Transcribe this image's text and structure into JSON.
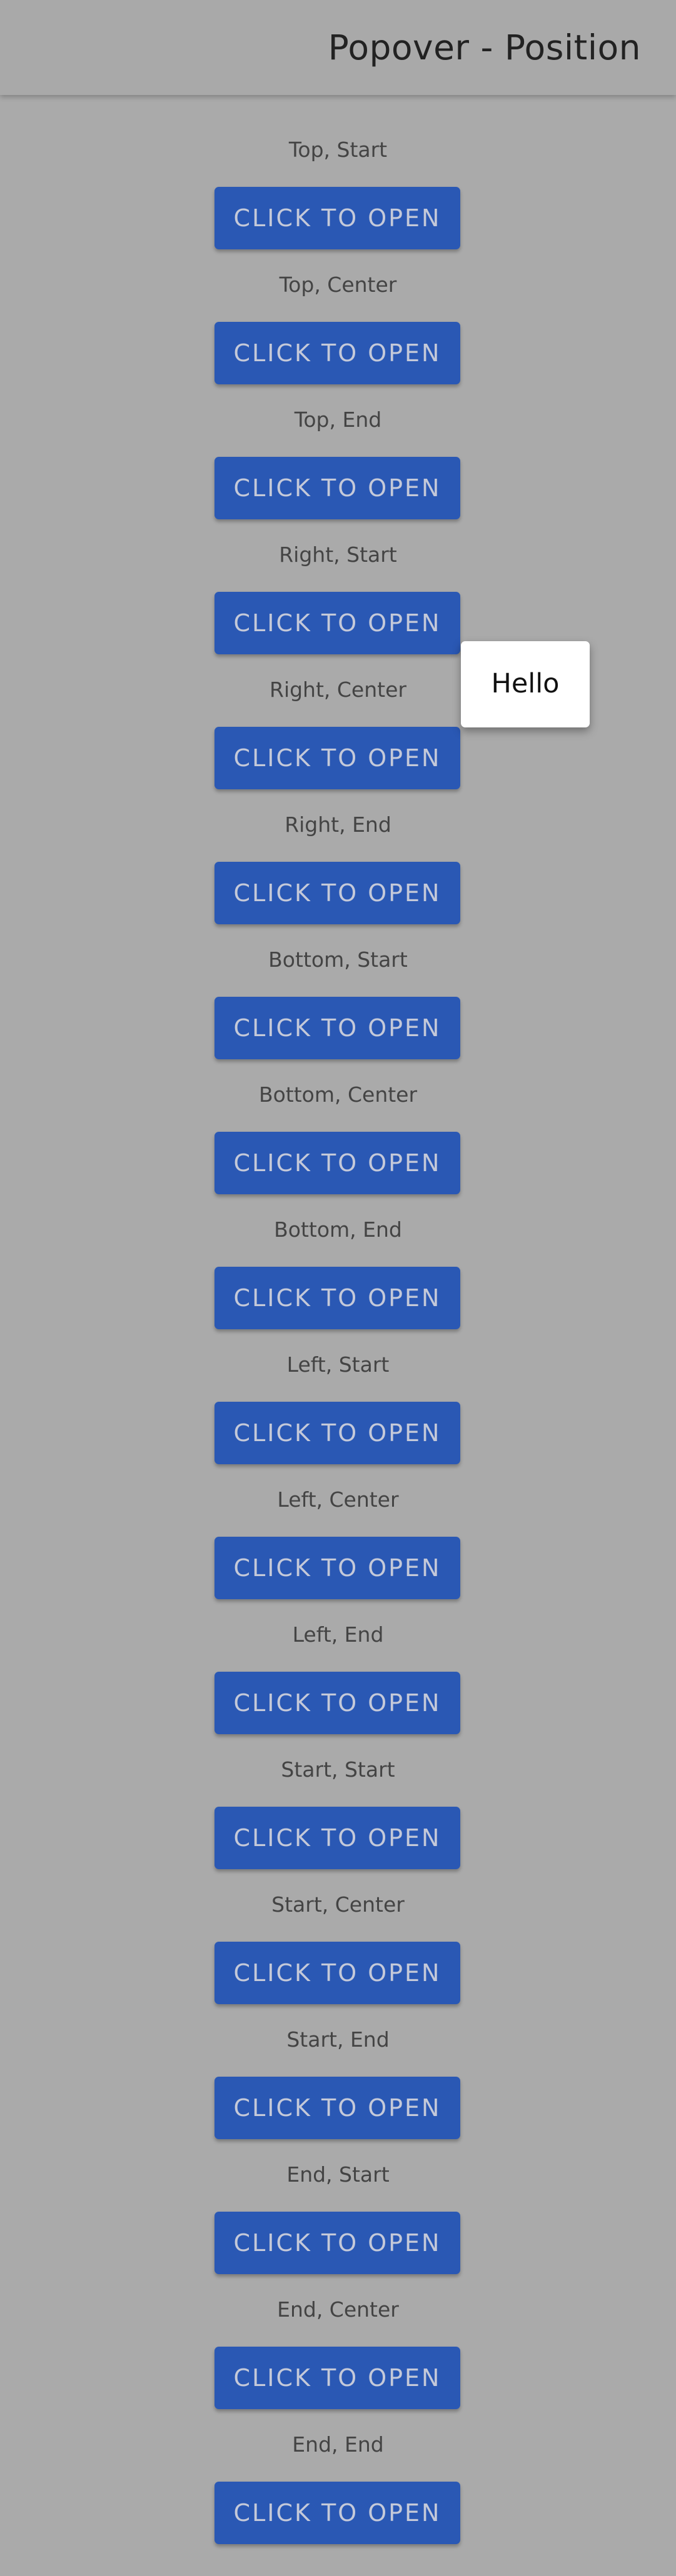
{
  "header": {
    "title": "Popover - Position"
  },
  "items": [
    {
      "label": "Top, Start",
      "button": "CLICK TO OPEN"
    },
    {
      "label": "Top, Center",
      "button": "CLICK TO OPEN"
    },
    {
      "label": "Top, End",
      "button": "CLICK TO OPEN"
    },
    {
      "label": "Right, Start",
      "button": "CLICK TO OPEN"
    },
    {
      "label": "Right, Center",
      "button": "CLICK TO OPEN"
    },
    {
      "label": "Right, End",
      "button": "CLICK TO OPEN"
    },
    {
      "label": "Bottom, Start",
      "button": "CLICK TO OPEN"
    },
    {
      "label": "Bottom, Center",
      "button": "CLICK TO OPEN"
    },
    {
      "label": "Bottom, End",
      "button": "CLICK TO OPEN"
    },
    {
      "label": "Left, Start",
      "button": "CLICK TO OPEN"
    },
    {
      "label": "Left, Center",
      "button": "CLICK TO OPEN"
    },
    {
      "label": "Left, End",
      "button": "CLICK TO OPEN"
    },
    {
      "label": "Start, Start",
      "button": "CLICK TO OPEN"
    },
    {
      "label": "Start, Center",
      "button": "CLICK TO OPEN"
    },
    {
      "label": "Start, End",
      "button": "CLICK TO OPEN"
    },
    {
      "label": "End, Start",
      "button": "CLICK TO OPEN"
    },
    {
      "label": "End, Center",
      "button": "CLICK TO OPEN"
    },
    {
      "label": "End, End",
      "button": "CLICK TO OPEN"
    }
  ],
  "popover": {
    "text": "Hello"
  },
  "colors": {
    "background": "#aaaaaa",
    "button": "#2a58b4",
    "button_text": "#c4c9d9",
    "popover": "#ffffff"
  }
}
